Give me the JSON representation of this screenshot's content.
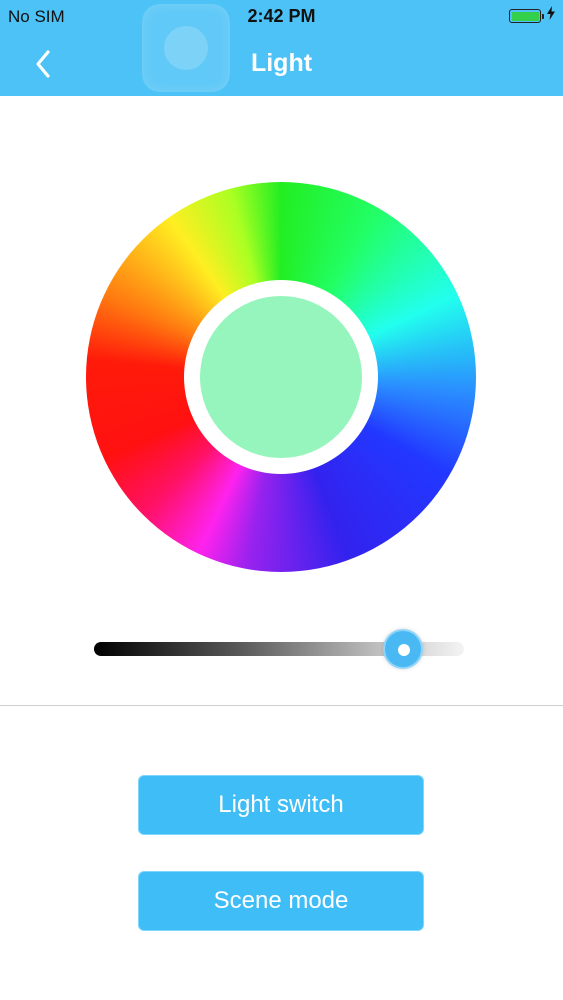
{
  "status_bar": {
    "carrier": "No SIM",
    "time": "2:42 PM",
    "battery_level": 1.0,
    "battery_color": "#35d04b",
    "charging_icon": "bolt-icon"
  },
  "header": {
    "title": "Light",
    "back_icon": "chevron-left-icon",
    "background": "#4cc2f6"
  },
  "color_picker": {
    "selected_color": "#95f5bc"
  },
  "brightness_slider": {
    "value": 0.835
  },
  "buttons": {
    "light_switch": "Light switch",
    "scene_mode": "Scene mode",
    "background": "#3fbdf7"
  }
}
